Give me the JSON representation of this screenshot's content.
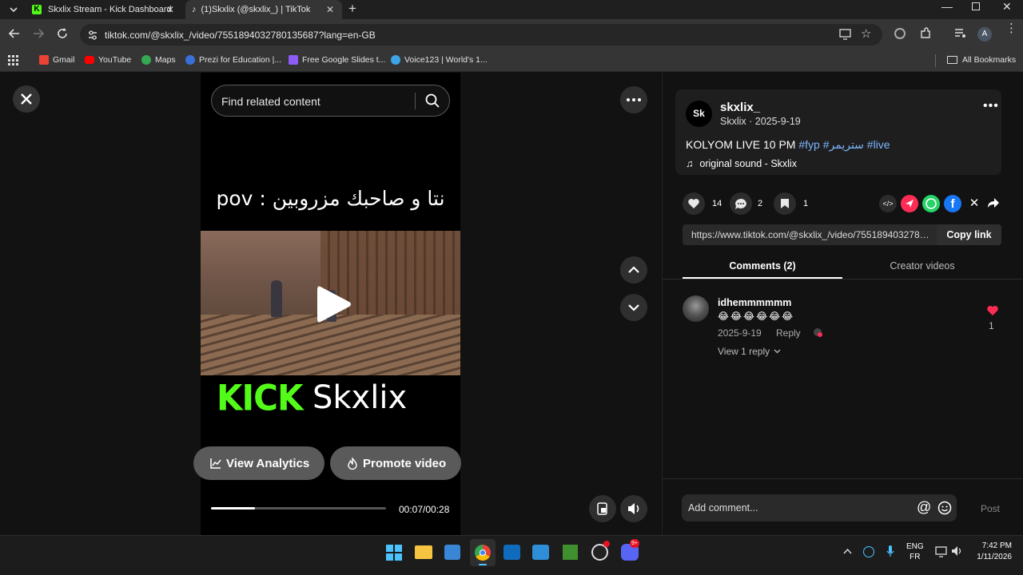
{
  "browser": {
    "tabs": [
      {
        "title": "Skxlix Stream - Kick Dashboard"
      },
      {
        "title": "(1)Skxlix (@skxlix_) | TikTok"
      }
    ],
    "url": "tiktok.com/@skxlix_/video/7551894032780135687?lang=en-GB",
    "bookmarks": [
      {
        "label": "Gmail"
      },
      {
        "label": "YouTube"
      },
      {
        "label": "Maps"
      },
      {
        "label": "Prezi for Education |..."
      },
      {
        "label": "Free Google Slides t..."
      },
      {
        "label": "Voice123 | World's 1..."
      }
    ],
    "all_bookmarks": "All Bookmarks",
    "profile_initial": "A"
  },
  "player": {
    "search_placeholder": "Find related content",
    "overlay_text": "نتا و صاحبك مزروبين : pov",
    "brand_kick": "KICK",
    "brand_name": "Skxlix",
    "view_analytics": "View Analytics",
    "promote_video": "Promote video",
    "time": "00:07/00:28",
    "progress": 0.25
  },
  "post": {
    "username": "skxlix_",
    "avatar_text": "Sk",
    "meta": "Skxlix · 2025-9-19",
    "caption_plain": "KOLYOM LIVE 10 PM ",
    "caption_tags": "#fyp #ستريمر #live",
    "sound": "original sound - Skxlix",
    "likes": "14",
    "comments": "2",
    "saves": "1",
    "link": "https://www.tiktok.com/@skxlix_/video/7551894032780135687",
    "copy_link": "Copy link",
    "tab_comments": "Comments (2)",
    "tab_creator": "Creator videos"
  },
  "comment": {
    "user": "idhemmmmmm",
    "emojis": "😂😂😂😂😂😂",
    "date": "2025-9-19",
    "reply": "Reply",
    "view_replies": "View 1 reply",
    "likes": "1"
  },
  "composer": {
    "placeholder": "Add comment...",
    "post": "Post"
  },
  "taskbar": {
    "lang1": "ENG",
    "lang2": "FR",
    "time": "7:42 PM",
    "date": "1/11/2026",
    "discord_badge": "9+"
  },
  "colors": {
    "tiktok_red": "#fe2c55",
    "kick_green": "#53fc18",
    "hashtag": "#7db4ff"
  }
}
